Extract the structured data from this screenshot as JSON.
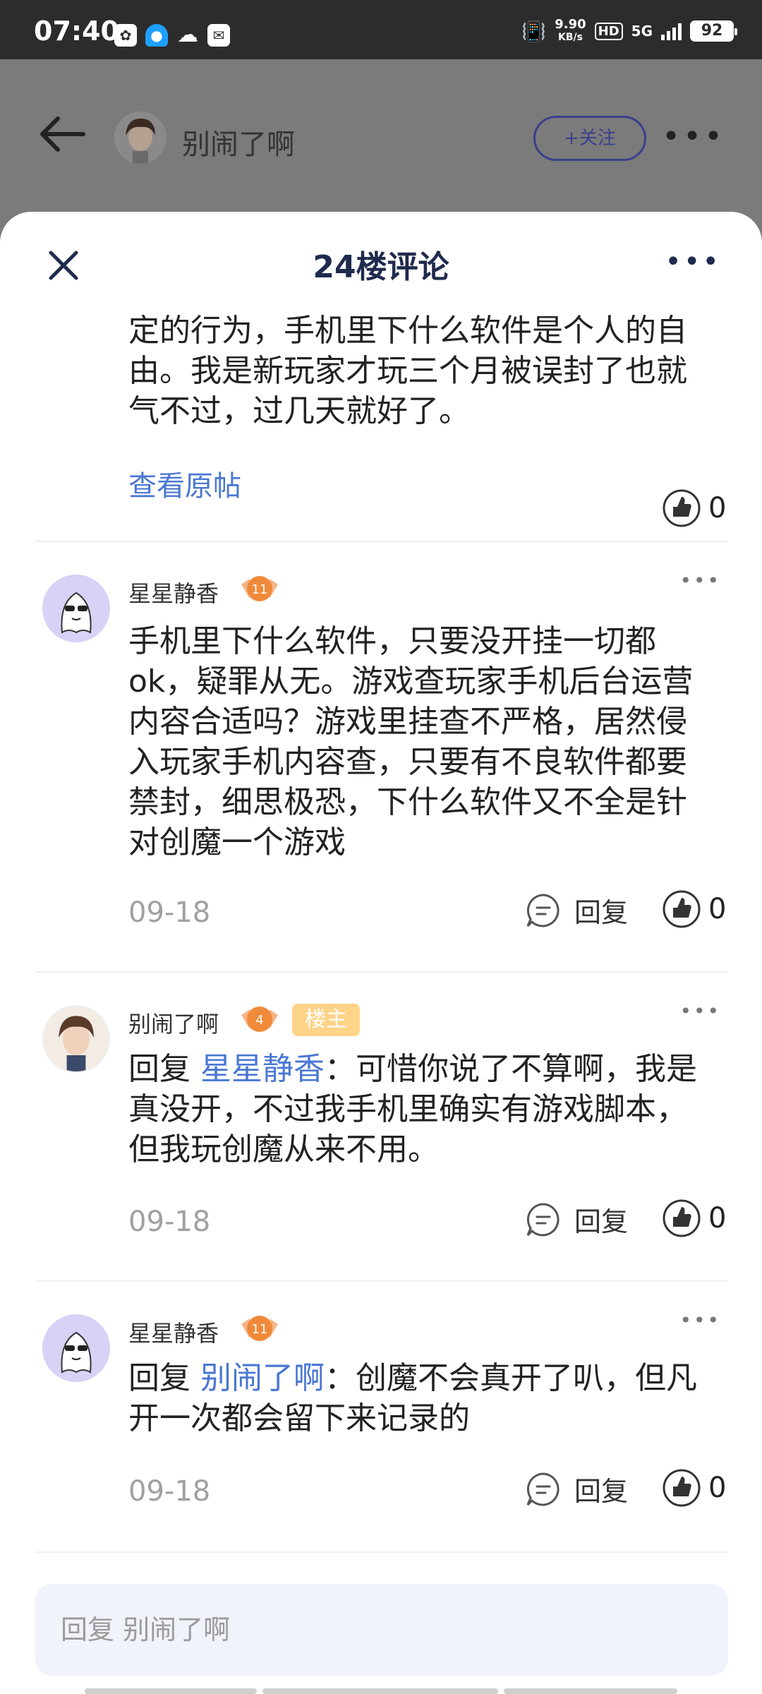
{
  "status_bar": {
    "time": "07:40",
    "net_speed_value": "9.90",
    "net_speed_unit": "KB/s",
    "hd": "HD",
    "network": "5G",
    "battery": "92",
    "icons": [
      "baidu-icon",
      "qq-icon",
      "cloud-icon",
      "message-icon",
      "vibrate-icon",
      "signal-icon"
    ]
  },
  "header": {
    "username": "别闹了啊",
    "follow_label": "+关注",
    "more_label": "•••"
  },
  "sheet": {
    "title": "24楼评论",
    "more_label": "•••"
  },
  "original_post": {
    "text": "定的行为，手机里下什么软件是个人的自由。我是新玩家才玩三个月被误封了也就气不过，过几天就好了。",
    "view_original": "查看原帖",
    "likes": "0"
  },
  "comments": [
    {
      "author": "星星静香",
      "level": "11",
      "badge": "",
      "reply_prefix": "",
      "mention": "",
      "text": "手机里下什么软件，只要没开挂一切都ok，疑罪从无。游戏查玩家手机后台运营内容合适吗？游戏里挂查不严格，居然侵入玩家手机内容查，只要有不良软件都要禁封，细思极恐，下什么软件又不全是针对创魔一个游戏",
      "date": "09-18",
      "reply_label": "回复",
      "likes": "0"
    },
    {
      "author": "别闹了啊",
      "level": "4",
      "badge": "楼主",
      "reply_prefix": "回复 ",
      "mention": "星星静香",
      "text": "：可惜你说了不算啊，我是真没开，不过我手机里确实有游戏脚本，但我玩创魔从来不用。",
      "date": "09-18",
      "reply_label": "回复",
      "likes": "0"
    },
    {
      "author": "星星静香",
      "level": "11",
      "badge": "",
      "reply_prefix": "回复 ",
      "mention": "别闹了啊",
      "text": "：创魔不会真开了叭，但凡开一次都会留下来记录的",
      "date": "09-18",
      "reply_label": "回复",
      "likes": "0"
    }
  ],
  "reply_input": {
    "placeholder": "回复 别闹了啊"
  },
  "colors": {
    "accent_blue": "#4a77d2",
    "title_navy": "#1f2a4d",
    "op_badge": "#ffd388",
    "level_badge": "#f08a3a",
    "input_bg": "#f1f3fc"
  }
}
